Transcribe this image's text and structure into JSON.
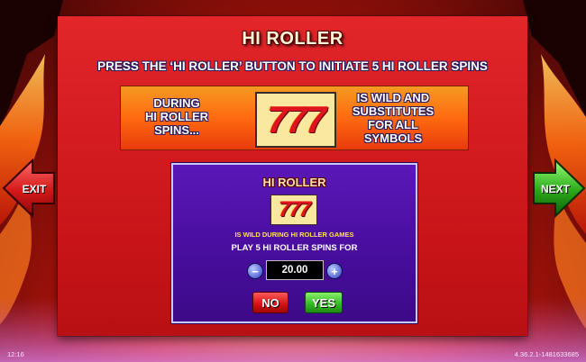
{
  "panel": {
    "title": "HI ROLLER",
    "instruction": "PRESS THE ‘HI ROLLER’ BUTTON TO INITIATE 5 HI ROLLER SPINS"
  },
  "banner": {
    "left_lines": [
      "DURING",
      "HI ROLLER",
      "SPINS..."
    ],
    "symbol": "777",
    "right_lines": [
      "IS WILD AND",
      "SUBSTITUTES",
      "FOR ALL",
      "SYMBOLS"
    ]
  },
  "dialog": {
    "title": "HI ROLLER",
    "symbol": "777",
    "wild_text": "IS WILD DURING HI ROLLER GAMES",
    "play_text": "PLAY 5 HI ROLLER SPINS FOR",
    "minus_label": "−",
    "plus_label": "+",
    "value": "20.00",
    "no_label": "NO",
    "yes_label": "YES"
  },
  "nav": {
    "exit_label": "EXIT",
    "next_label": "NEXT"
  },
  "footer": {
    "time": "12:16",
    "version": "4.36.2.1-1481633685"
  },
  "colors": {
    "panel_red": "#d01a1e",
    "dialog_purple": "#4a0ea0",
    "exit_red": "#d41818",
    "next_green": "#2aa818",
    "wild_yellow": "#ffe24a"
  }
}
